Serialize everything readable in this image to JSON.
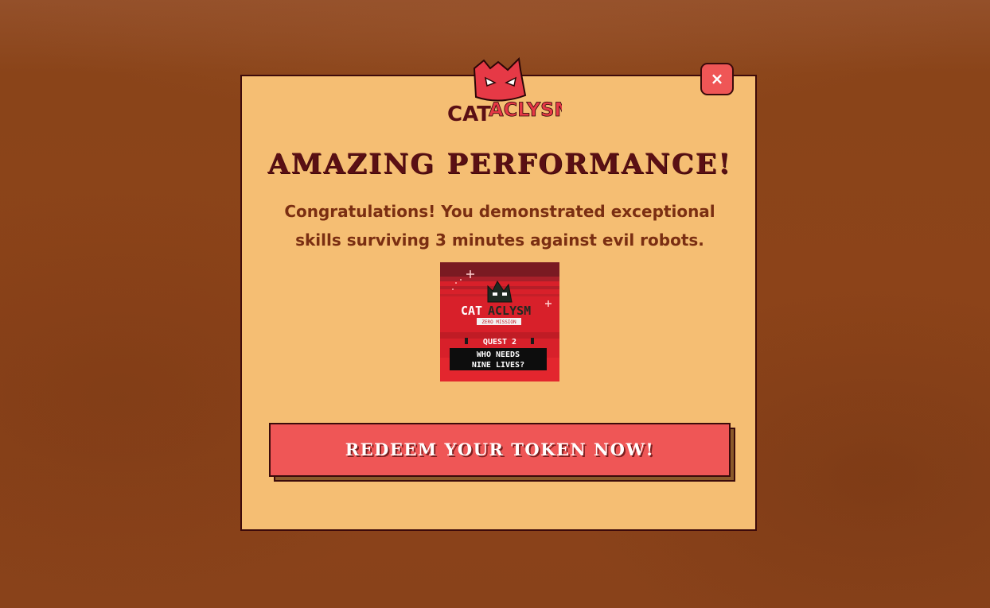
{
  "modal": {
    "close_label": "×",
    "title": "AMAZING PERFORMANCE!",
    "message": "Congratulations! You demonstrated exceptional skills surviving 3 minutes against evil robots.",
    "redeem_label": "REDEEM YOUR TOKEN NOW!"
  },
  "logo": {
    "text_left": "CAT",
    "text_right": "ACLYSM"
  },
  "quest_image": {
    "logo_left": "CAT",
    "logo_right": "ACLYSM",
    "tag": "ZERO MISSION",
    "quest_label": "QUEST 2",
    "caption_line1": "WHO NEEDS",
    "caption_line2": "NINE LIVES?"
  },
  "colors": {
    "background": "#8c4319",
    "modal": "#f5be73",
    "accent_red": "#ef5656",
    "border": "#3d0a0a",
    "title_text": "#5a0f14",
    "message_text": "#7a2e12"
  }
}
